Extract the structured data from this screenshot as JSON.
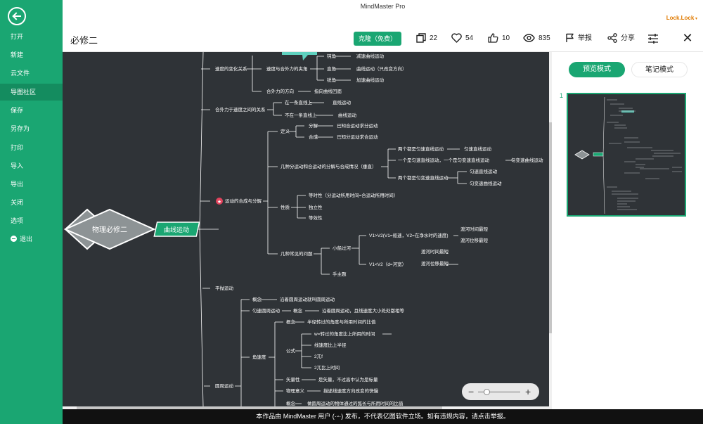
{
  "window": {
    "title": "MindMaster Pro",
    "user": "Lock.Lock"
  },
  "sidebar": {
    "items": [
      {
        "label": "打开"
      },
      {
        "label": "新建"
      },
      {
        "label": "云文件"
      },
      {
        "label": "导图社区"
      },
      {
        "label": "保存"
      },
      {
        "label": "另存为"
      },
      {
        "label": "打印"
      },
      {
        "label": "导入"
      },
      {
        "label": "导出"
      },
      {
        "label": "关闭"
      },
      {
        "label": "选项"
      },
      {
        "label": "退出"
      }
    ],
    "active_index": 3
  },
  "header": {
    "doc_title": "必修二",
    "clone_label": "克隆（免费）",
    "stats": {
      "copies": "22",
      "likes": "54",
      "thumbs": "10",
      "views": "835"
    },
    "report_label": "举报",
    "share_label": "分享"
  },
  "panel": {
    "preview_label": "预览模式",
    "notes_label": "笔记模式",
    "page_number": "1"
  },
  "footer": {
    "notice": "本作品由 MindMaster 用户 (·ᵕ·) 发布，不代表亿图软件立场。如有违规内容，请点击举报。"
  },
  "mindmap": {
    "root": "物理必修二",
    "main": "曲线运动",
    "n_speed_change": "速度的变化关系",
    "n_speed_force": "速度与合外力的夹角",
    "n_obtuse": "钝角",
    "n_dec": "减速曲线运动",
    "n_right": "直角",
    "n_uniform": "曲线运动（只改变方向）",
    "n_acute": "锐角",
    "n_acc": "加速曲线运动",
    "n_force_dir": "合外力的方向",
    "n_force_dir_v": "指向曲线凹面",
    "n_force_speed": "合外力于速度之间的关系",
    "n_same_line": "在一条直线上",
    "n_straight": "直线运动",
    "n_not_line": "不在一条直线上",
    "n_curve": "曲线运动",
    "n_composition": "运动的合成与分解",
    "n_def": "定义",
    "n_decomp": "分解",
    "n_decomp_v": "已知合运动求分运动",
    "n_comp": "合成",
    "n_comp_v": "已知分运动求合运动",
    "n_cases": "几种分运动和合运动的分解与合成情况（垂直）",
    "n_both_uniform": "两个都是匀速直线运动",
    "n_uniform_line": "匀速直线运动",
    "n_one_each": "一个是匀速直线运动，一个是匀变速直线运动",
    "n_varying_curve": "匀变速曲线运动",
    "n_both_varying": "两个都是匀变速直线运动",
    "n_uniform_line2": "匀速直线运动",
    "n_varying_curve2": "匀变速曲线运动",
    "n_property": "性质",
    "n_equal_time": "等时性（分运动所用时间=合运动所用时间）",
    "n_independent": "独立性",
    "n_equivalent": "等效性",
    "n_common": "几种常见的问题",
    "n_boat": "小船过河",
    "n_v1gtv2": "V1>V2(V1=船速，V2=在净水时的速度)",
    "n_shortest_time": "渡河时间最短",
    "n_shortest_disp": "渡河位移最短",
    "n_v1ltv2": "V1<V2（d=河宽）",
    "n_shortest_time2": "渡河时间最短",
    "n_shortest_disp2": "渡河位移最短",
    "n_hand": "手主题",
    "n_projectile": "平抛运动",
    "n_concept": "概念",
    "n_concept_v": "沿着圆周运动就叫圆周运动",
    "n_uniform_circ": "匀速圆周运动",
    "n_concept2": "概念",
    "n_concept2_v": "沿着圆周运动，且线速度大小处处都相等",
    "n_concept3": "概念",
    "n_concept3_v": "半径转过的角度与所用时间的比值",
    "n_omega_def": "w=转过的角度比上所用的时间",
    "n_line_speed": "线速度比上半径",
    "n_2pif": "2兀f",
    "n_2pit": "2兀比上时间",
    "n_formula": "公式",
    "n_angular": "角速度",
    "n_vector": "矢量性",
    "n_vector_v": "是矢量，不过高中认为是标量",
    "n_meaning": "物理意义",
    "n_meaning_v": "描述线速度方向改变的快慢",
    "n_circular": "圆周运动",
    "n_concept4": "概念",
    "n_concept4_v": "做圆周运动的物体通过的弧长与所用时间的比值"
  }
}
